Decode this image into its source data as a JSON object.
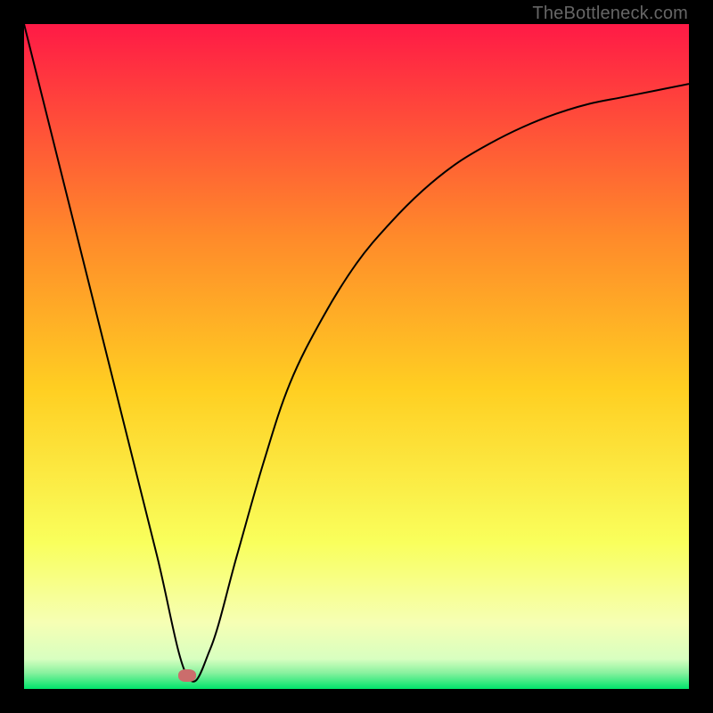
{
  "watermark": "TheBottleneck.com",
  "colors": {
    "top": "#ff1a46",
    "upper_mid": "#ff8a2a",
    "mid": "#ffcf22",
    "lower_mid": "#f9ff5c",
    "pale": "#f6ffb4",
    "bottom": "#00e46b",
    "curve": "#000000",
    "marker": "#cb6d6c",
    "frame": "#000000"
  },
  "chart_data": {
    "type": "line",
    "title": "",
    "xlabel": "",
    "ylabel": "",
    "xlim": [
      0,
      100
    ],
    "ylim": [
      0,
      100
    ],
    "series": [
      {
        "name": "bottleneck-curve",
        "x": [
          0,
          5,
          10,
          15,
          20,
          24.5,
          28,
          32,
          36,
          40,
          45,
          50,
          55,
          60,
          65,
          70,
          75,
          80,
          85,
          90,
          95,
          100
        ],
        "y": [
          100,
          80,
          60,
          40,
          20,
          2,
          6,
          20,
          34,
          46,
          56,
          64,
          70,
          75,
          79,
          82,
          84.5,
          86.5,
          88,
          89,
          90,
          91
        ]
      }
    ],
    "marker": {
      "x": 24.5,
      "y": 2
    },
    "gradient_bands": [
      {
        "stop": 0.0,
        "color": "#ff1a46"
      },
      {
        "stop": 0.32,
        "color": "#ff8a2a"
      },
      {
        "stop": 0.55,
        "color": "#ffcf22"
      },
      {
        "stop": 0.78,
        "color": "#f9ff5c"
      },
      {
        "stop": 0.9,
        "color": "#f6ffb4"
      },
      {
        "stop": 0.955,
        "color": "#d8ffc0"
      },
      {
        "stop": 0.975,
        "color": "#8cf2a0"
      },
      {
        "stop": 1.0,
        "color": "#00e46b"
      }
    ]
  }
}
